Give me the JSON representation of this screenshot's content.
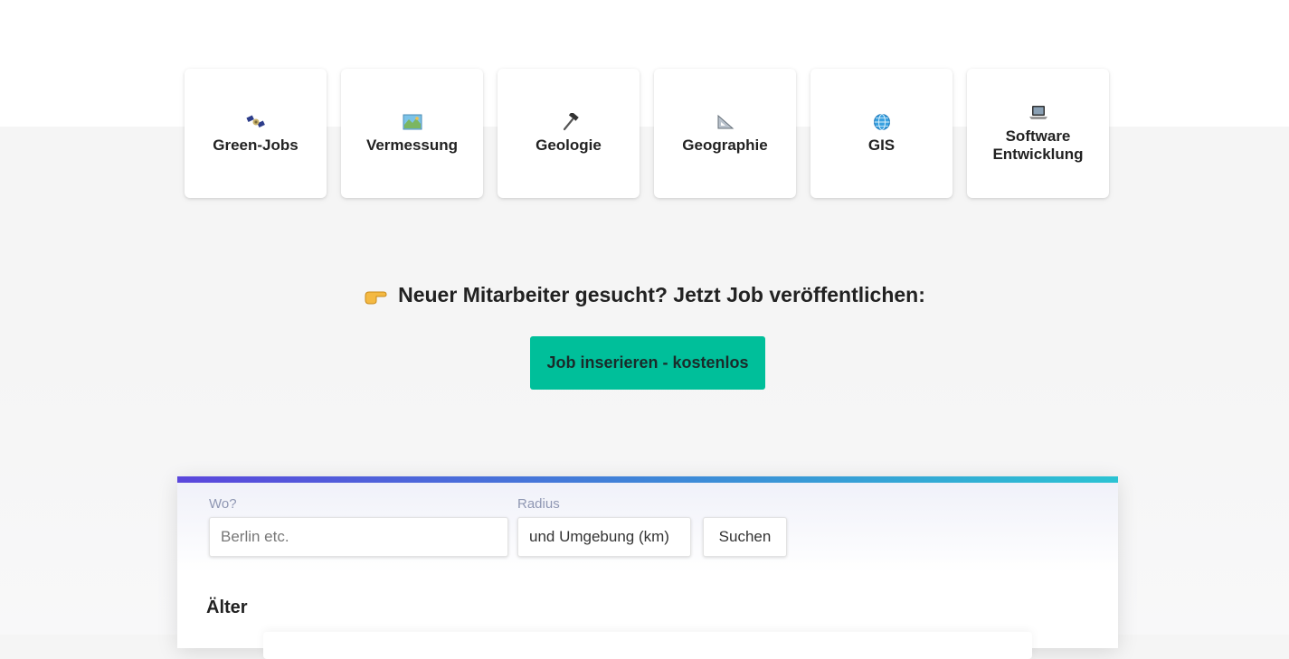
{
  "categories": [
    {
      "label": "Green-Jobs",
      "icon": "satellite-icon"
    },
    {
      "label": "Vermessung",
      "icon": "map-icon"
    },
    {
      "label": "Geologie",
      "icon": "hammer-icon"
    },
    {
      "label": "Geographie",
      "icon": "triangle-ruler-icon"
    },
    {
      "label": "GIS",
      "icon": "globe-icon"
    },
    {
      "label": "Software Entwicklung",
      "icon": "laptop-icon"
    }
  ],
  "cta": {
    "heading": "Neuer Mitarbeiter gesucht? Jetzt Job veröffentlichen:",
    "button_label": "Job inserieren - kostenlos",
    "icon": "pointing-hand-icon"
  },
  "search": {
    "where_label": "Wo?",
    "where_placeholder": "Berlin etc.",
    "radius_label": "Radius",
    "radius_value": "und Umgebung (km)",
    "submit_label": "Suchen"
  },
  "section_heading": "Älter",
  "colors": {
    "cta_button": "#00bf9a",
    "gradient_start": "#5b47dc",
    "gradient_end": "#2bc3d3",
    "label_color": "#8f97b3"
  }
}
